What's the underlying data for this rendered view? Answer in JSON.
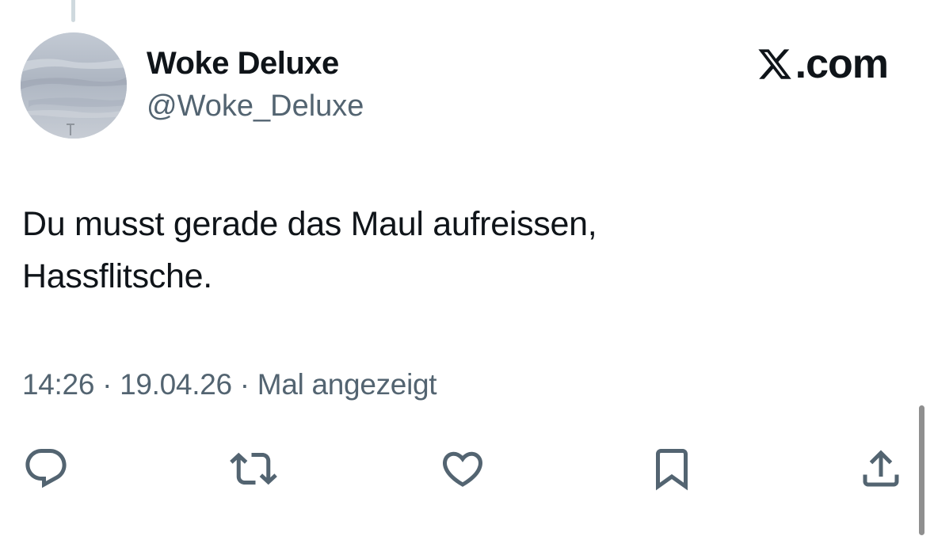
{
  "tweet": {
    "author": {
      "display_name": "Woke Deluxe",
      "handle": "@Woke_Deluxe",
      "avatar_icon": "sky-photo-avatar"
    },
    "brand": {
      "logo_icon": "x-logo-icon",
      "suffix": ".com"
    },
    "text_lines": [
      "Du musst gerade das Maul aufreissen,",
      "Hassflitsche."
    ],
    "meta": {
      "time": "14:26",
      "date": "19.04.26",
      "views": "Mal angezeigt",
      "separator": "·"
    },
    "actions": [
      {
        "name": "reply",
        "icon": "reply-icon"
      },
      {
        "name": "retweet",
        "icon": "retweet-icon"
      },
      {
        "name": "like",
        "icon": "heart-icon"
      },
      {
        "name": "bookmark",
        "icon": "bookmark-icon"
      },
      {
        "name": "share",
        "icon": "share-icon"
      }
    ],
    "colors": {
      "text_primary": "#0f1419",
      "text_secondary": "#536471",
      "thread_line": "#cfd9de"
    }
  }
}
